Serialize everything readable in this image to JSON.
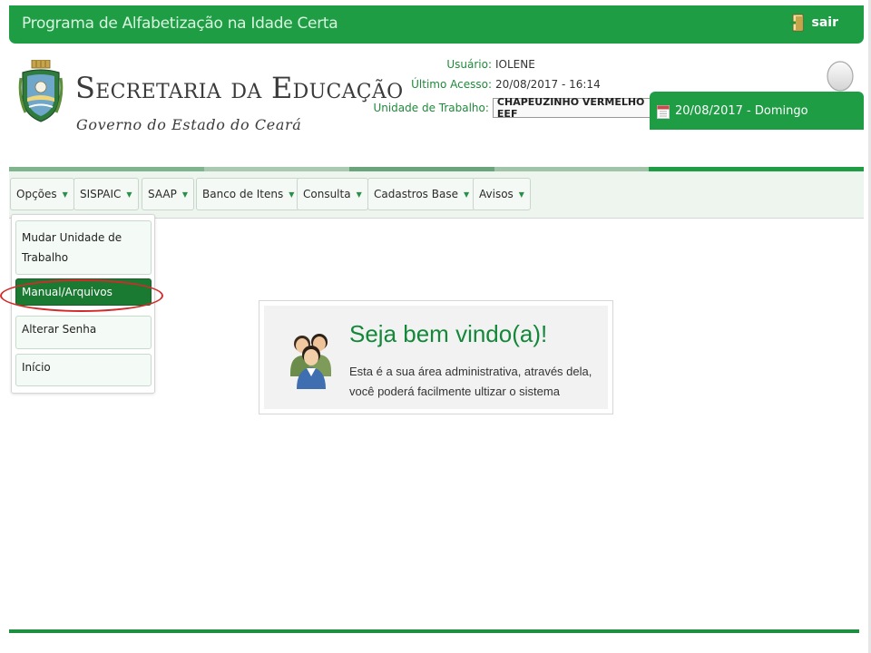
{
  "topbar": {
    "title": "Programa de Alfabetização na Idade Certa",
    "logout_label": "sair",
    "logout_icon": "door-exit-icon"
  },
  "brand": {
    "title": "Secretaria da Educação",
    "subtitle": "Governo do Estado do Ceará",
    "crest_icon": "coat-of-arms-icon"
  },
  "user": {
    "user_label": "Usuário:",
    "user_value": "IOLENE",
    "last_access_label": "Último Acesso:",
    "last_access_value": "20/08/2017 - 16:14",
    "work_unit_label": "Unidade de Trabalho:",
    "work_unit_value": "CHAPEUZINHO VERMELHO EEF",
    "avatar_icon": "user-avatar-icon"
  },
  "datebar": {
    "date": "20/08/2017 - Domingo",
    "icon": "calendar-icon"
  },
  "nav": {
    "items": [
      {
        "label": "Opções"
      },
      {
        "label": "SISPAIC"
      },
      {
        "label": "SAAP"
      },
      {
        "label": "Banco de Itens"
      },
      {
        "label": "Consulta"
      },
      {
        "label": "Cadastros Base"
      },
      {
        "label": "Avisos"
      }
    ]
  },
  "dropdown": {
    "items": [
      {
        "label": "Mudar Unidade de Trabalho"
      },
      {
        "label": "Manual/Arquivos"
      },
      {
        "label": "Alterar Senha"
      },
      {
        "label": "Início"
      }
    ],
    "active_index": 1
  },
  "welcome": {
    "title": "Seja bem vindo(a)!",
    "text": "Esta é a sua área administrativa, através dela, você poderá facilmente ultizar o sistema",
    "icon": "users-group-icon"
  },
  "colors": {
    "brand_green": "#1e9d45",
    "menu_active": "#1b7a32",
    "highlight_red": "#d22a2a"
  }
}
